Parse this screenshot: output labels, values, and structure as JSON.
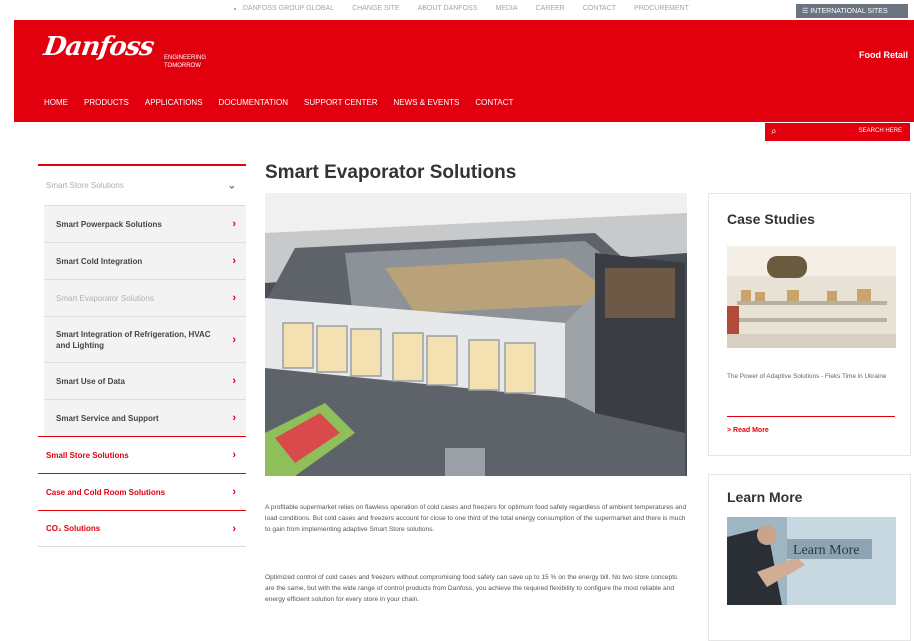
{
  "topbar": {
    "links": [
      "DANFOSS GROUP GLOBAL",
      "CHANGE SITE",
      "ABOUT DANFOSS",
      "MEDIA",
      "CAREER",
      "CONTACT",
      "PROCUREMENT"
    ],
    "intl_label": "INTERNATIONAL SITES"
  },
  "header": {
    "logo_text": "Danfoss",
    "tagline": "ENGINEERING TOMORROW",
    "site_name": "Food Retail",
    "nav": [
      "HOME",
      "PRODUCTS",
      "APPLICATIONS",
      "DOCUMENTATION",
      "SUPPORT CENTER",
      "NEWS & EVENTS",
      "CONTACT"
    ],
    "search_label": "SEARCH HERE"
  },
  "sidebar": {
    "section_title": "Smart Store Solutions",
    "subitems": [
      {
        "label": "Smart Powerpack Solutions",
        "active": false
      },
      {
        "label": "Smart Cold Integration",
        "active": false
      },
      {
        "label": "Smart Evaporator Solutions",
        "active": true
      },
      {
        "label": "Smart Integration of Refrigeration, HVAC and Lighting",
        "active": false
      },
      {
        "label": "Smart Use of Data",
        "active": false
      },
      {
        "label": "Smart Service and Support",
        "active": false
      }
    ],
    "main_items": [
      {
        "label": "Small Store Solutions"
      },
      {
        "label": "Case and Cold Room Solutions"
      },
      {
        "label": "CO₂ Solutions"
      }
    ]
  },
  "content": {
    "title": "Smart Evaporator Solutions",
    "paragraph1": "A profitable supermarket relies on flawless operation of cold cases and freezers for optimum food safety regardless of ambient temperatures and load conditions. But cold cases and freezers account for close to one third of the total energy consumption of the supermarket and there is much to gain from implementing adaptive Smart Store solutions.",
    "paragraph2": "Optimized control of cold cases and freezers without compromising food safety can save up to 15 % on the energy bill. No two store concepts are the same, but with the wide range of control products from Danfoss, you achieve the required flexibility to configure the most reliable and energy efficient solution for every store in your chain."
  },
  "case_studies": {
    "heading": "Case Studies",
    "caption": "The Power of Adaptive Solutions - Fleks Time in Ukraine",
    "read_more": "> Read More"
  },
  "learn_more": {
    "heading": "Learn More",
    "image_text": "Learn More"
  },
  "colors": {
    "brand_red": "#e2000f",
    "grey_button": "#6b7480"
  }
}
